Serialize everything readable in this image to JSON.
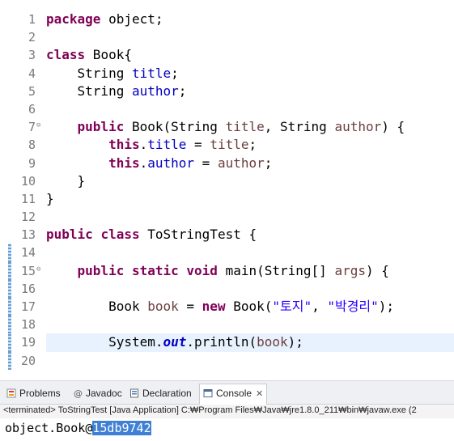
{
  "editor": {
    "lines": [
      {
        "n": "1",
        "tokens": [
          {
            "t": "package",
            "c": "kw"
          },
          {
            "t": " object;"
          }
        ]
      },
      {
        "n": "2",
        "tokens": []
      },
      {
        "n": "3",
        "tokens": [
          {
            "t": "class",
            "c": "kw"
          },
          {
            "t": " Book{"
          }
        ]
      },
      {
        "n": "4",
        "tokens": [
          {
            "t": "    String "
          },
          {
            "t": "title",
            "c": "fld"
          },
          {
            "t": ";"
          }
        ]
      },
      {
        "n": "5",
        "tokens": [
          {
            "t": "    String "
          },
          {
            "t": "author",
            "c": "fld"
          },
          {
            "t": ";"
          }
        ]
      },
      {
        "n": "6",
        "tokens": []
      },
      {
        "n": "7",
        "fold": true,
        "tokens": [
          {
            "t": "    "
          },
          {
            "t": "public",
            "c": "kw"
          },
          {
            "t": " Book(String "
          },
          {
            "t": "title",
            "c": "param"
          },
          {
            "t": ", String "
          },
          {
            "t": "author",
            "c": "param"
          },
          {
            "t": ") {"
          }
        ]
      },
      {
        "n": "8",
        "tokens": [
          {
            "t": "        "
          },
          {
            "t": "this",
            "c": "kw"
          },
          {
            "t": "."
          },
          {
            "t": "title",
            "c": "fld"
          },
          {
            "t": " = "
          },
          {
            "t": "title",
            "c": "param"
          },
          {
            "t": ";"
          }
        ]
      },
      {
        "n": "9",
        "tokens": [
          {
            "t": "        "
          },
          {
            "t": "this",
            "c": "kw"
          },
          {
            "t": "."
          },
          {
            "t": "author",
            "c": "fld"
          },
          {
            "t": " = "
          },
          {
            "t": "author",
            "c": "param"
          },
          {
            "t": ";"
          }
        ]
      },
      {
        "n": "10",
        "tokens": [
          {
            "t": "    }"
          }
        ]
      },
      {
        "n": "11",
        "tokens": [
          {
            "t": "}"
          }
        ]
      },
      {
        "n": "12",
        "tokens": []
      },
      {
        "n": "13",
        "tokens": [
          {
            "t": "public",
            "c": "kw"
          },
          {
            "t": " "
          },
          {
            "t": "class",
            "c": "kw"
          },
          {
            "t": " ToStringTest {"
          }
        ]
      },
      {
        "n": "14",
        "marker": true,
        "tokens": []
      },
      {
        "n": "15",
        "marker": true,
        "fold": true,
        "tokens": [
          {
            "t": "    "
          },
          {
            "t": "public",
            "c": "kw"
          },
          {
            "t": " "
          },
          {
            "t": "static",
            "c": "kw"
          },
          {
            "t": " "
          },
          {
            "t": "void",
            "c": "kw"
          },
          {
            "t": " main(String[] "
          },
          {
            "t": "args",
            "c": "param"
          },
          {
            "t": ") {"
          }
        ]
      },
      {
        "n": "16",
        "marker": true,
        "tokens": []
      },
      {
        "n": "17",
        "marker": true,
        "tokens": [
          {
            "t": "        Book "
          },
          {
            "t": "book",
            "c": "local"
          },
          {
            "t": " = "
          },
          {
            "t": "new",
            "c": "kw"
          },
          {
            "t": " Book("
          },
          {
            "t": "\"토지\"",
            "c": "str"
          },
          {
            "t": ", "
          },
          {
            "t": "\"박경리\"",
            "c": "str"
          },
          {
            "t": ");"
          }
        ]
      },
      {
        "n": "18",
        "marker": true,
        "tokens": []
      },
      {
        "n": "19",
        "marker": true,
        "current": true,
        "tokens": [
          {
            "t": "        System."
          },
          {
            "t": "out",
            "c": "statfld"
          },
          {
            "t": ".println("
          },
          {
            "t": "book",
            "c": "local"
          },
          {
            "t": ");"
          }
        ]
      },
      {
        "n": "20",
        "marker": true,
        "tokens": []
      }
    ]
  },
  "views": {
    "tabs": [
      {
        "label": "Problems",
        "icon": "problems-icon",
        "active": false
      },
      {
        "label": "Javadoc",
        "icon": "javadoc-icon",
        "active": false
      },
      {
        "label": "Declaration",
        "icon": "declaration-icon",
        "active": false
      },
      {
        "label": "Console",
        "icon": "console-icon",
        "active": true,
        "close": "✕"
      }
    ],
    "terminated": "<terminated> ToStringTest [Java Application] C:₩Program Files₩Java₩jre1.8.0_211₩bin₩javaw.exe (2",
    "output_prefix": "object.Book@",
    "output_hash": "15db9742"
  }
}
